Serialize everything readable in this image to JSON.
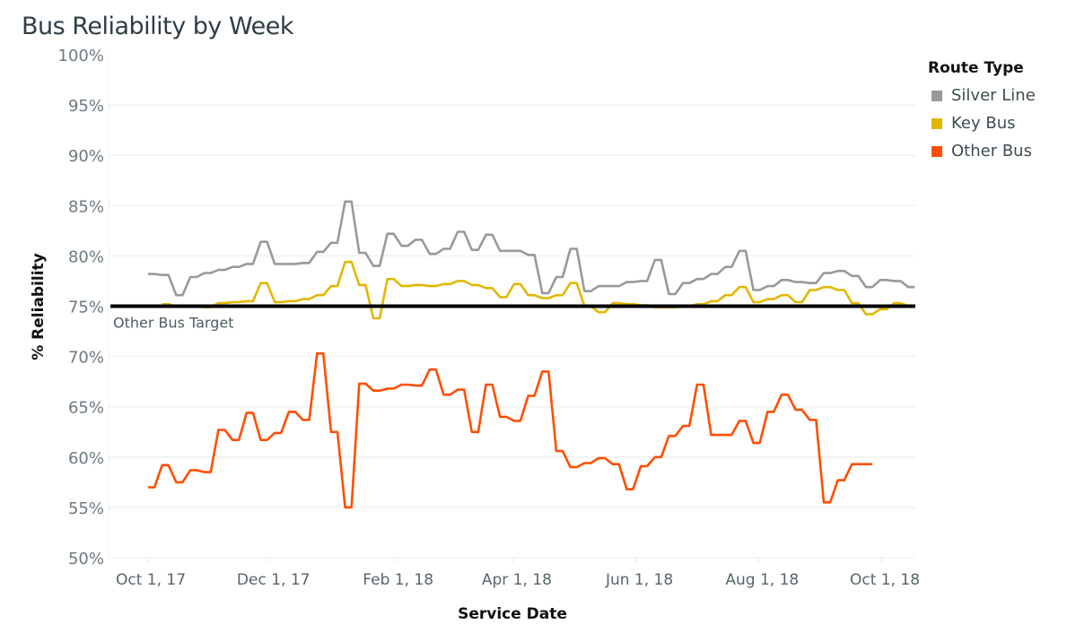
{
  "chart_data": {
    "type": "line",
    "title": "Bus Reliability by Week",
    "xlabel": "Service Date",
    "ylabel": "% Reliability",
    "ylim": [
      50,
      100
    ],
    "yticks": [
      "100%",
      "95%",
      "90%",
      "85%",
      "80%",
      "75%",
      "70%",
      "65%",
      "60%",
      "55%",
      "50%"
    ],
    "ytick_values": [
      100,
      95,
      90,
      85,
      80,
      75,
      70,
      65,
      60,
      55,
      50
    ],
    "xticks": [
      "Oct 1, 17",
      "Dec 1, 17",
      "Feb 1, 18",
      "Apr 1, 18",
      "Jun 1, 18",
      "Aug 1, 18",
      "Oct 1, 18"
    ],
    "xtick_days": [
      0,
      61,
      123,
      182,
      243,
      304,
      365
    ],
    "x_start": "Oct 1, 17",
    "x_step_days": 7,
    "grid": true,
    "legend": {
      "title": "Route Type",
      "placement": "top-right",
      "items": [
        {
          "name": "Silver Line",
          "color": "#999999"
        },
        {
          "name": "Key Bus",
          "color": "#e2b700"
        },
        {
          "name": "Other Bus",
          "color": "#ff4e00"
        }
      ]
    },
    "reference_line": {
      "value": 75,
      "label": "Other Bus Target",
      "color": "#000000"
    },
    "series": [
      {
        "name": "Silver Line",
        "color": "#999999",
        "values": [
          78.2,
          78.1,
          76.1,
          77.9,
          78.3,
          78.6,
          78.9,
          79.2,
          81.4,
          79.2,
          79.2,
          79.3,
          80.4,
          81.3,
          85.4,
          80.3,
          79.0,
          82.2,
          81.0,
          81.6,
          80.2,
          80.7,
          82.4,
          80.6,
          82.1,
          80.5,
          80.5,
          80.1,
          76.3,
          77.9,
          80.7,
          76.5,
          77.0,
          77.0,
          77.4,
          77.5,
          79.6,
          76.2,
          77.3,
          77.7,
          78.2,
          78.9,
          80.5,
          76.6,
          77.0,
          77.6,
          77.4,
          77.3,
          78.3,
          78.5,
          78.0,
          76.9,
          77.6,
          77.5,
          76.9
        ]
      },
      {
        "name": "Key Bus",
        "color": "#e2b700",
        "values": [
          null,
          75.2,
          75.0,
          75.0,
          74.9,
          75.3,
          75.4,
          75.5,
          77.3,
          75.4,
          75.5,
          75.7,
          76.1,
          77.0,
          79.4,
          77.1,
          73.8,
          77.7,
          77.0,
          77.1,
          77.0,
          77.2,
          77.5,
          77.1,
          76.8,
          75.9,
          77.2,
          76.1,
          75.8,
          76.1,
          77.3,
          75.0,
          74.4,
          75.3,
          75.2,
          75.1,
          74.9,
          74.9,
          75.0,
          75.2,
          75.5,
          76.1,
          76.9,
          75.4,
          75.7,
          76.1,
          75.4,
          76.6,
          76.9,
          76.6,
          75.3,
          74.2,
          74.7,
          75.3,
          75.0
        ]
      },
      {
        "name": "Other Bus",
        "color": "#ff4e00",
        "values": [
          57.0,
          59.2,
          57.5,
          58.7,
          58.5,
          62.7,
          61.7,
          64.4,
          61.7,
          62.4,
          64.5,
          63.7,
          70.3,
          62.5,
          55.0,
          67.3,
          66.6,
          66.8,
          67.2,
          67.1,
          68.7,
          66.2,
          66.7,
          62.5,
          67.2,
          64.0,
          63.6,
          66.1,
          68.5,
          60.6,
          59.0,
          59.4,
          59.9,
          59.3,
          56.8,
          59.1,
          60.0,
          62.1,
          63.1,
          67.2,
          62.2,
          62.2,
          63.6,
          61.4,
          64.5,
          66.2,
          64.7,
          63.7,
          55.5,
          57.7,
          59.3,
          59.3
        ]
      }
    ]
  }
}
